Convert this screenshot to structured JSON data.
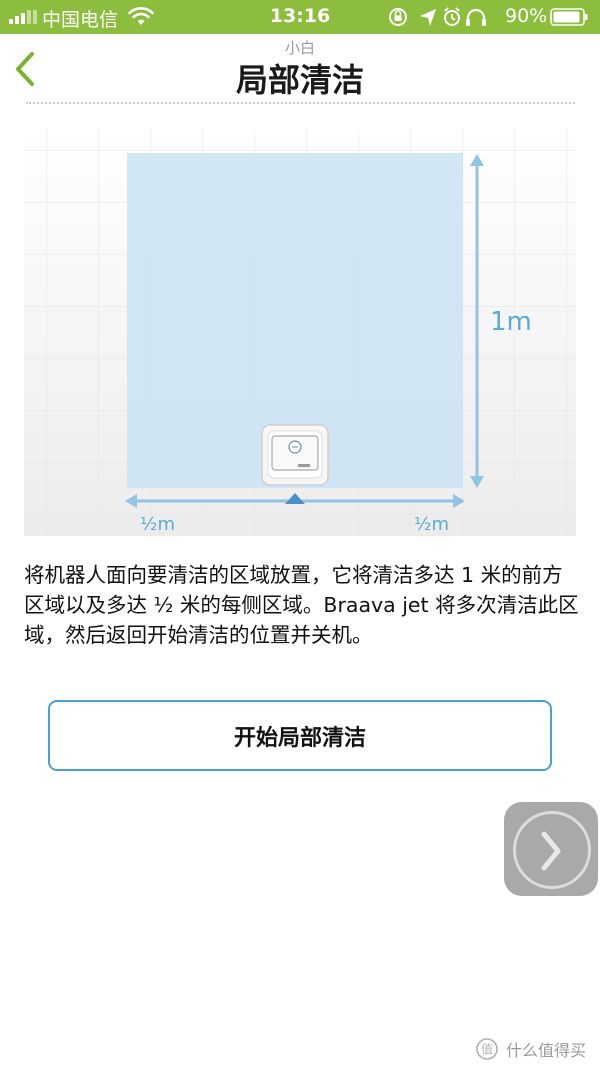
{
  "status_bar": {
    "carrier": "中国电信",
    "time": "13:16",
    "battery_percent": "90%",
    "signal_icon": "signal-bars-icon",
    "wifi_icon": "wifi-icon",
    "status_icons": [
      "rotation-lock-icon",
      "location-arrow-icon",
      "alarm-icon",
      "headphones-icon"
    ],
    "battery_icon": "battery-icon"
  },
  "header": {
    "watermark": "小白",
    "title": "局部清洁",
    "back_icon": "chevron-left-icon"
  },
  "diagram": {
    "height_label": "1m",
    "left_width_label": "½m",
    "right_width_label": "½m",
    "area_color": "#cfe6f5",
    "arrow_color": "#8fc4e6",
    "robot_icon": "robot-mop-icon"
  },
  "description": "将机器人面向要清洁的区域放置，它将清洁多达 1 米的前方区域以及多达 ½ 米的每侧区域。Braava jet 将多次清洁此区域，然后返回开始清洁的位置并关机。",
  "actions": {
    "start_label": "开始局部清洁"
  },
  "floating": {
    "assistive_icon": "chevron-right-icon"
  },
  "footer": {
    "site_name": "什么值得买",
    "site_logo": "zhi-logo-icon"
  },
  "colors": {
    "status_bar": "#8cbd3c",
    "accent_green": "#7ab234",
    "button_border": "#4a9fd8"
  }
}
